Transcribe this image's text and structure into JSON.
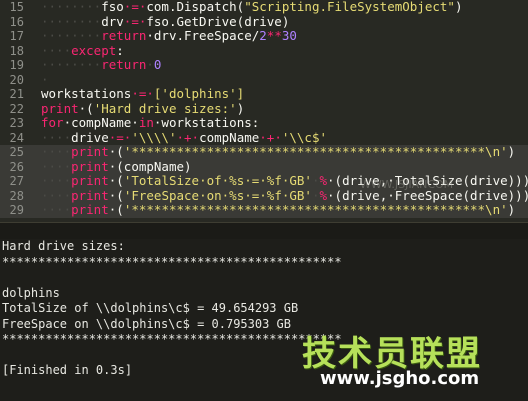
{
  "editor": {
    "lines": [
      {
        "num": "15",
        "tokens": [
          {
            "t": "········",
            "c": "ws"
          },
          {
            "t": "fso",
            "c": "plain"
          },
          {
            "t": "·=·",
            "c": "kw"
          },
          {
            "t": "com.Dispatch(",
            "c": "plain"
          },
          {
            "t": "\"Scripting.FileSystemObject\"",
            "c": "str"
          },
          {
            "t": ")",
            "c": "plain"
          }
        ]
      },
      {
        "num": "16",
        "tokens": [
          {
            "t": "········",
            "c": "ws"
          },
          {
            "t": "drv",
            "c": "plain"
          },
          {
            "t": "·=·",
            "c": "kw"
          },
          {
            "t": "fso.GetDrive(drive)",
            "c": "plain"
          }
        ]
      },
      {
        "num": "17",
        "tokens": [
          {
            "t": "········",
            "c": "ws"
          },
          {
            "t": "return",
            "c": "kw"
          },
          {
            "t": "·drv.FreeSpace/",
            "c": "plain"
          },
          {
            "t": "2",
            "c": "num"
          },
          {
            "t": "**",
            "c": "kw"
          },
          {
            "t": "30",
            "c": "num"
          }
        ]
      },
      {
        "num": "18",
        "tokens": [
          {
            "t": "····",
            "c": "ws"
          },
          {
            "t": "except",
            "c": "kw"
          },
          {
            "t": ":",
            "c": "plain"
          }
        ]
      },
      {
        "num": "19",
        "tokens": [
          {
            "t": "········",
            "c": "ws"
          },
          {
            "t": "return",
            "c": "kw"
          },
          {
            "t": "·",
            "c": "ws"
          },
          {
            "t": "0",
            "c": "num"
          }
        ]
      },
      {
        "num": "20",
        "tokens": [
          {
            "t": "·",
            "c": "ws"
          }
        ]
      },
      {
        "num": "21",
        "tokens": [
          {
            "t": "workstations",
            "c": "plain"
          },
          {
            "t": "·=·",
            "c": "kw"
          },
          {
            "t": "['dolphins']",
            "c": "str"
          }
        ]
      },
      {
        "num": "22",
        "tokens": [
          {
            "t": "print",
            "c": "kw"
          },
          {
            "t": "·(",
            "c": "plain"
          },
          {
            "t": "'Hard drive sizes:'",
            "c": "str"
          },
          {
            "t": ")",
            "c": "plain"
          }
        ]
      },
      {
        "num": "23",
        "tokens": [
          {
            "t": "for",
            "c": "kw"
          },
          {
            "t": "·compName·",
            "c": "plain"
          },
          {
            "t": "in",
            "c": "kw"
          },
          {
            "t": "·workstations:",
            "c": "plain"
          }
        ]
      },
      {
        "num": "24",
        "tokens": [
          {
            "t": "····",
            "c": "ws"
          },
          {
            "t": "drive",
            "c": "plain"
          },
          {
            "t": "·=·",
            "c": "kw"
          },
          {
            "t": "'\\\\\\\\'",
            "c": "str"
          },
          {
            "t": "·+·",
            "c": "kw"
          },
          {
            "t": "compName",
            "c": "plain"
          },
          {
            "t": "·+·",
            "c": "kw"
          },
          {
            "t": "'\\\\c$'",
            "c": "str"
          }
        ]
      },
      {
        "num": "25",
        "sel": true,
        "tokens": [
          {
            "t": "····",
            "c": "ws"
          },
          {
            "t": "print",
            "c": "kw"
          },
          {
            "t": "·(",
            "c": "plain"
          },
          {
            "t": "'***********************************************\\n'",
            "c": "str"
          },
          {
            "t": ")",
            "c": "plain"
          }
        ]
      },
      {
        "num": "26",
        "sel": true,
        "tokens": [
          {
            "t": "····",
            "c": "ws"
          },
          {
            "t": "print",
            "c": "kw"
          },
          {
            "t": "·(compName)",
            "c": "plain"
          }
        ]
      },
      {
        "num": "27",
        "sel": true,
        "tokens": [
          {
            "t": "····",
            "c": "ws"
          },
          {
            "t": "print",
            "c": "kw"
          },
          {
            "t": "·(",
            "c": "plain"
          },
          {
            "t": "'TotalSize·of·%s·=·%f·GB'",
            "c": "str"
          },
          {
            "t": "·",
            "c": "ws"
          },
          {
            "t": "%",
            "c": "kw"
          },
          {
            "t": "·(drive,·TotalSize(drive)))",
            "c": "plain"
          }
        ]
      },
      {
        "num": "28",
        "sel": true,
        "tokens": [
          {
            "t": "····",
            "c": "ws"
          },
          {
            "t": "print",
            "c": "kw"
          },
          {
            "t": "·(",
            "c": "plain"
          },
          {
            "t": "'FreeSpace·on·%s·=·%f·GB'",
            "c": "str"
          },
          {
            "t": "·",
            "c": "ws"
          },
          {
            "t": "%",
            "c": "kw"
          },
          {
            "t": "·(drive,·FreeSpace(drive)))",
            "c": "plain"
          }
        ]
      },
      {
        "num": "29",
        "sel": true,
        "tokens": [
          {
            "t": "····",
            "c": "ws"
          },
          {
            "t": "print",
            "c": "kw"
          },
          {
            "t": "·(",
            "c": "plain"
          },
          {
            "t": "'***********************************************\\n'",
            "c": "str"
          },
          {
            "t": ")",
            "c": "plain"
          }
        ]
      }
    ]
  },
  "console": {
    "lines": [
      "Hard drive sizes:",
      "***********************************************",
      "",
      "dolphins",
      "TotalSize of \\\\dolphins\\c$ = 49.654293 GB",
      "FreeSpace on \\\\dolphins\\c$ = 0.795303 GB",
      "***********************************************",
      "",
      "[Finished in 0.3s]"
    ]
  },
  "watermark": {
    "cn": "技术员联盟",
    "url": "www.jsgho.com",
    "faint": "WWW.JSJIANCOM"
  }
}
